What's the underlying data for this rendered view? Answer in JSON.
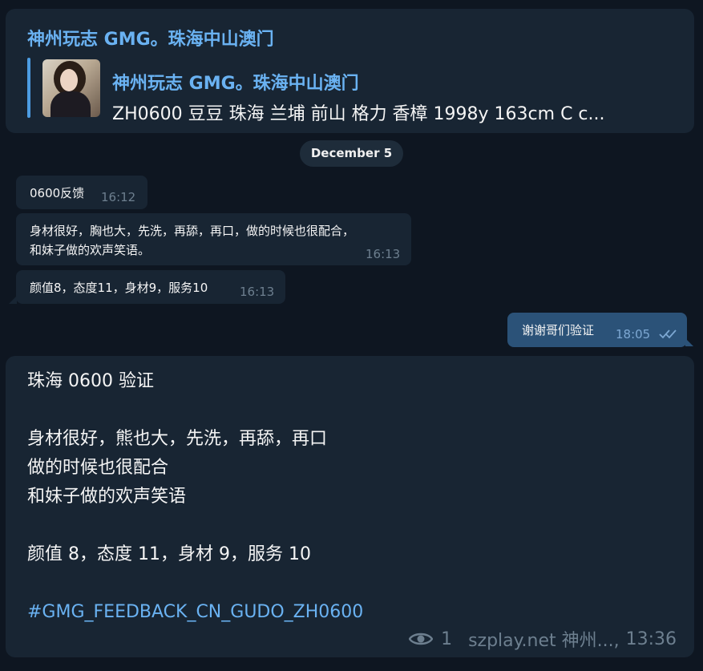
{
  "header": {
    "channel_name": "神州玩志 GMG。珠海中山澳门"
  },
  "reply": {
    "title": "神州玩志 GMG。珠海中山澳门",
    "preview": "ZH0600 豆豆 珠海 兰埔 前山 格力 香樟 1998y  163cm  C c..."
  },
  "date_separator": "December 5",
  "incoming_messages": [
    {
      "text": "0600反馈",
      "time": "16:12"
    },
    {
      "text_line1": "身材很好，胸也大，先洗，再舔，再口，做的时候也很配合，",
      "text_line2": "和妹子做的欢声笑语。",
      "time": "16:13"
    },
    {
      "text": "颜值8，态度11，身材9，服务10",
      "time": "16:13"
    }
  ],
  "outgoing_message": {
    "text": "谢谢哥们验证",
    "time": "18:05",
    "status_icon": "double-check-icon"
  },
  "post": {
    "lines": [
      "珠海 0600 验证",
      "",
      "身材很好，熊也大，先洗，再舔，再口",
      "做的时候也很配合",
      "和妹子做的欢声笑语",
      "",
      "颜值 8，态度 11，身材 9，服务 10",
      "",
      "#GMG_FEEDBACK_CN_GUDO_ZH0600"
    ],
    "views": "1",
    "signature": "szplay.net 神州...,",
    "time": "13:36",
    "views_icon": "eye-icon"
  },
  "colors": {
    "background": "#0e1621",
    "bubble_incoming": "#182533",
    "bubble_outgoing": "#2b5278",
    "accent": "#6ab2f2",
    "meta": "#6d7f8f"
  }
}
